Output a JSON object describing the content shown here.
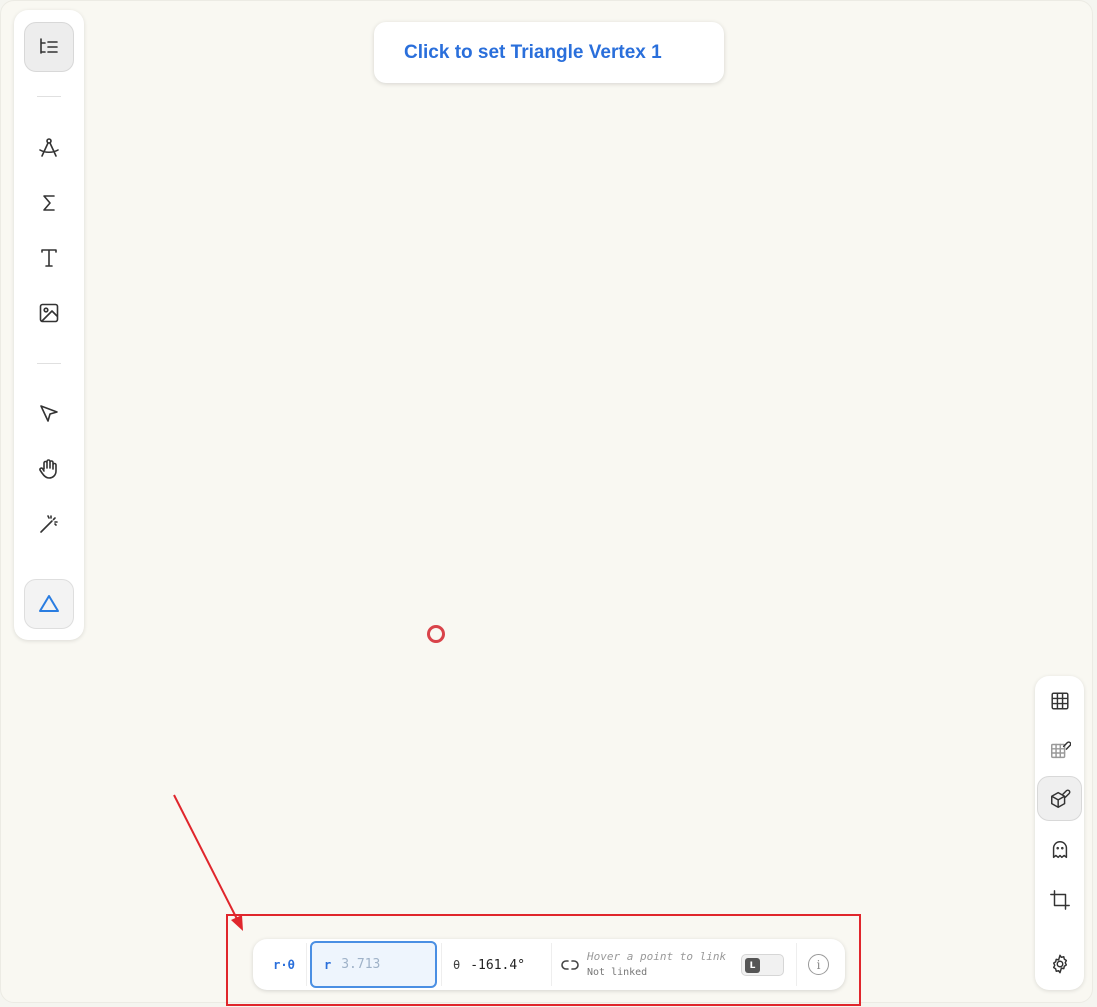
{
  "prompt": {
    "text": "Click to set Triangle Vertex 1"
  },
  "left_toolbar": {
    "tools": [
      {
        "name": "outline-icon"
      },
      {
        "name": "compass-icon"
      },
      {
        "name": "sigma-icon"
      },
      {
        "name": "text-icon"
      },
      {
        "name": "image-icon"
      },
      {
        "name": "pointer-icon"
      },
      {
        "name": "hand-icon"
      },
      {
        "name": "magic-wand-icon"
      },
      {
        "name": "triangle-icon"
      }
    ],
    "active_tool": "triangle-icon"
  },
  "coord_bar": {
    "mode_label": "r·θ",
    "r_label": "r",
    "r_placeholder": "3.713",
    "theta_label": "θ",
    "theta_value": "-161.4°",
    "hover_text": "Hover a point to link",
    "link_status": "Not linked",
    "toggle_label": "L",
    "info_label": "i"
  },
  "right_toolbar": {
    "tools": [
      {
        "name": "grid-icon"
      },
      {
        "name": "grid-snap-icon"
      },
      {
        "name": "cube-snap-icon"
      },
      {
        "name": "ghost-icon"
      },
      {
        "name": "crop-icon"
      },
      {
        "name": "settings-icon"
      }
    ]
  },
  "colors": {
    "accent": "#2a6fdb",
    "cursor": "#d9434a",
    "annotation": "#e0262c",
    "canvas": "#f9f8f2"
  }
}
